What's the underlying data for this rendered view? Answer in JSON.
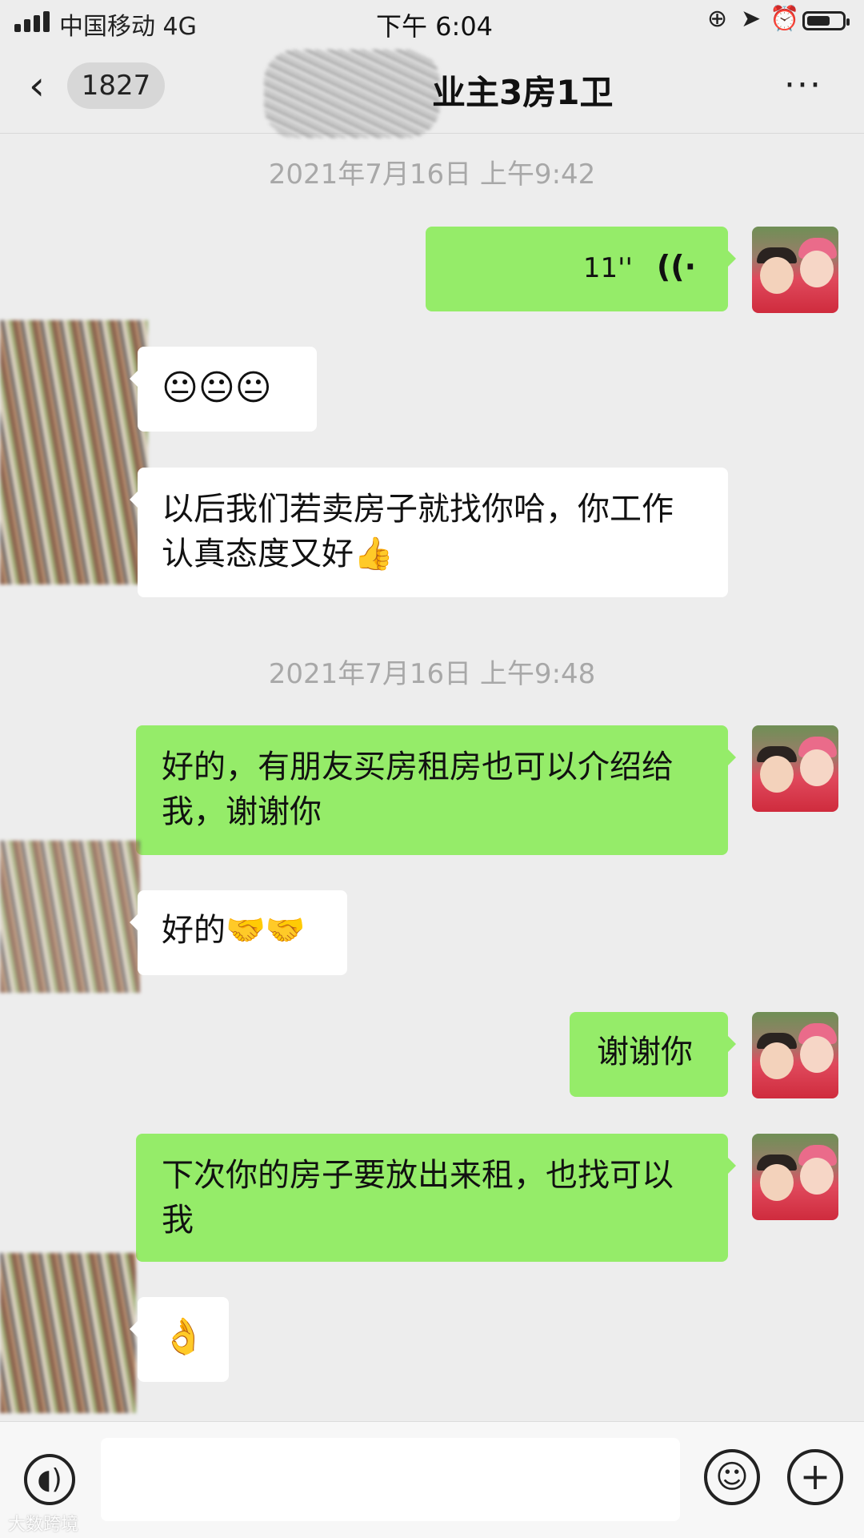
{
  "status_bar": {
    "carrier": "中国移动  4G",
    "time": "下午 6:04"
  },
  "header": {
    "back_badge": "1827",
    "title": "业主3房1卫",
    "more": "···"
  },
  "messages": [
    {
      "type": "timestamp",
      "text": "2021年7月16日 上午9:42"
    },
    {
      "sender": "me",
      "kind": "voice",
      "duration": "11''"
    },
    {
      "sender": "other",
      "text": "😐😐😐"
    },
    {
      "sender": "other",
      "text": "以后我们若卖房子就找你哈，你工作认真态度又好👍"
    },
    {
      "type": "timestamp",
      "text": "2021年7月16日 上午9:48"
    },
    {
      "sender": "me",
      "text": "好的，有朋友买房租房也可以介绍给我，谢谢你"
    },
    {
      "sender": "other",
      "text": "好的🤝🤝"
    },
    {
      "sender": "me",
      "text": "谢谢你"
    },
    {
      "sender": "me",
      "text": "下次你的房子要放出来租，也找可以我"
    },
    {
      "sender": "other",
      "text": "👌"
    }
  ],
  "bottom_bar": {
    "voice_icon": "voice-input-icon",
    "emoji_icon": "emoji-icon",
    "plus_icon": "plus-icon",
    "input_value": ""
  },
  "watermark": "大数跨境"
}
